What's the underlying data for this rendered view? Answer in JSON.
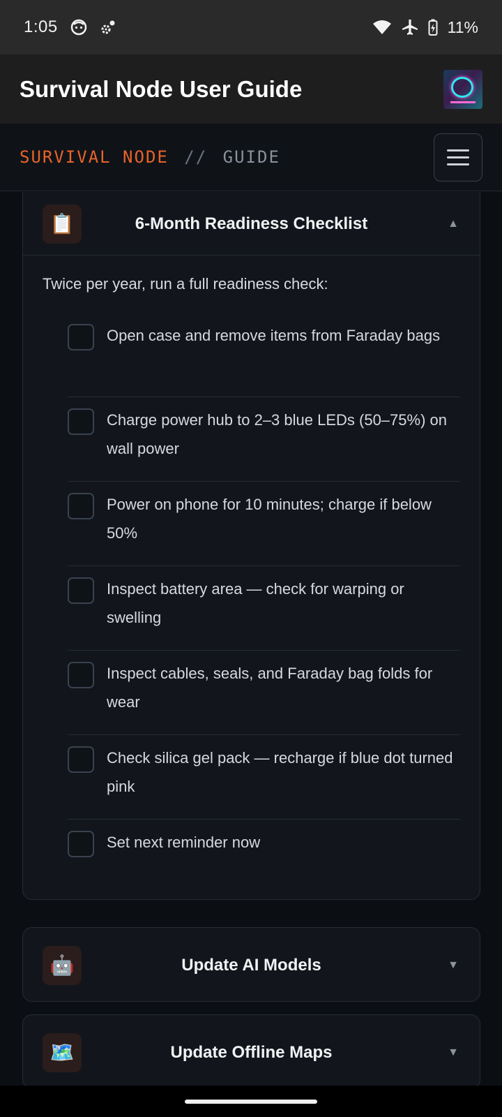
{
  "status_bar": {
    "time": "1:05",
    "battery_percent": "11%",
    "icons": [
      "face-icon",
      "gear-notification-icon",
      "wifi-icon",
      "airplane-icon",
      "battery-charging-icon"
    ]
  },
  "app_bar": {
    "title": "Survival Node User Guide"
  },
  "site_header": {
    "brand_main": "SURVIVAL NODE",
    "brand_separator": "//",
    "brand_sub": "GUIDE",
    "menu_icon": "hamburger-menu-icon"
  },
  "sections": {
    "checklist": {
      "icon": "📋",
      "title": "6-Month Readiness Checklist",
      "chevron": "▲",
      "expanded": true,
      "intro": "Twice per year, run a full readiness check:",
      "items": [
        {
          "text": "Open case and remove items from Faraday bags",
          "checked": false
        },
        {
          "text": "Charge power hub to 2–3 blue LEDs (50–75%) on wall power",
          "checked": false
        },
        {
          "text": "Power on phone for 10 minutes; charge if below 50%",
          "checked": false
        },
        {
          "text": "Inspect battery area — check for warping or swelling",
          "checked": false
        },
        {
          "text": "Inspect cables, seals, and Faraday bag folds for wear",
          "checked": false
        },
        {
          "text": "Check silica gel pack — recharge if blue dot turned pink",
          "checked": false
        },
        {
          "text": "Set next reminder now",
          "checked": false
        }
      ]
    },
    "ai_models": {
      "icon": "🤖",
      "title": "Update AI Models",
      "chevron": "▼",
      "expanded": false
    },
    "offline_maps": {
      "icon": "🗺️",
      "title": "Update Offline Maps",
      "chevron": "▼",
      "expanded": false
    }
  },
  "colors": {
    "accent": "#e8632a",
    "background": "#0b0f14",
    "card": "#12161c"
  }
}
